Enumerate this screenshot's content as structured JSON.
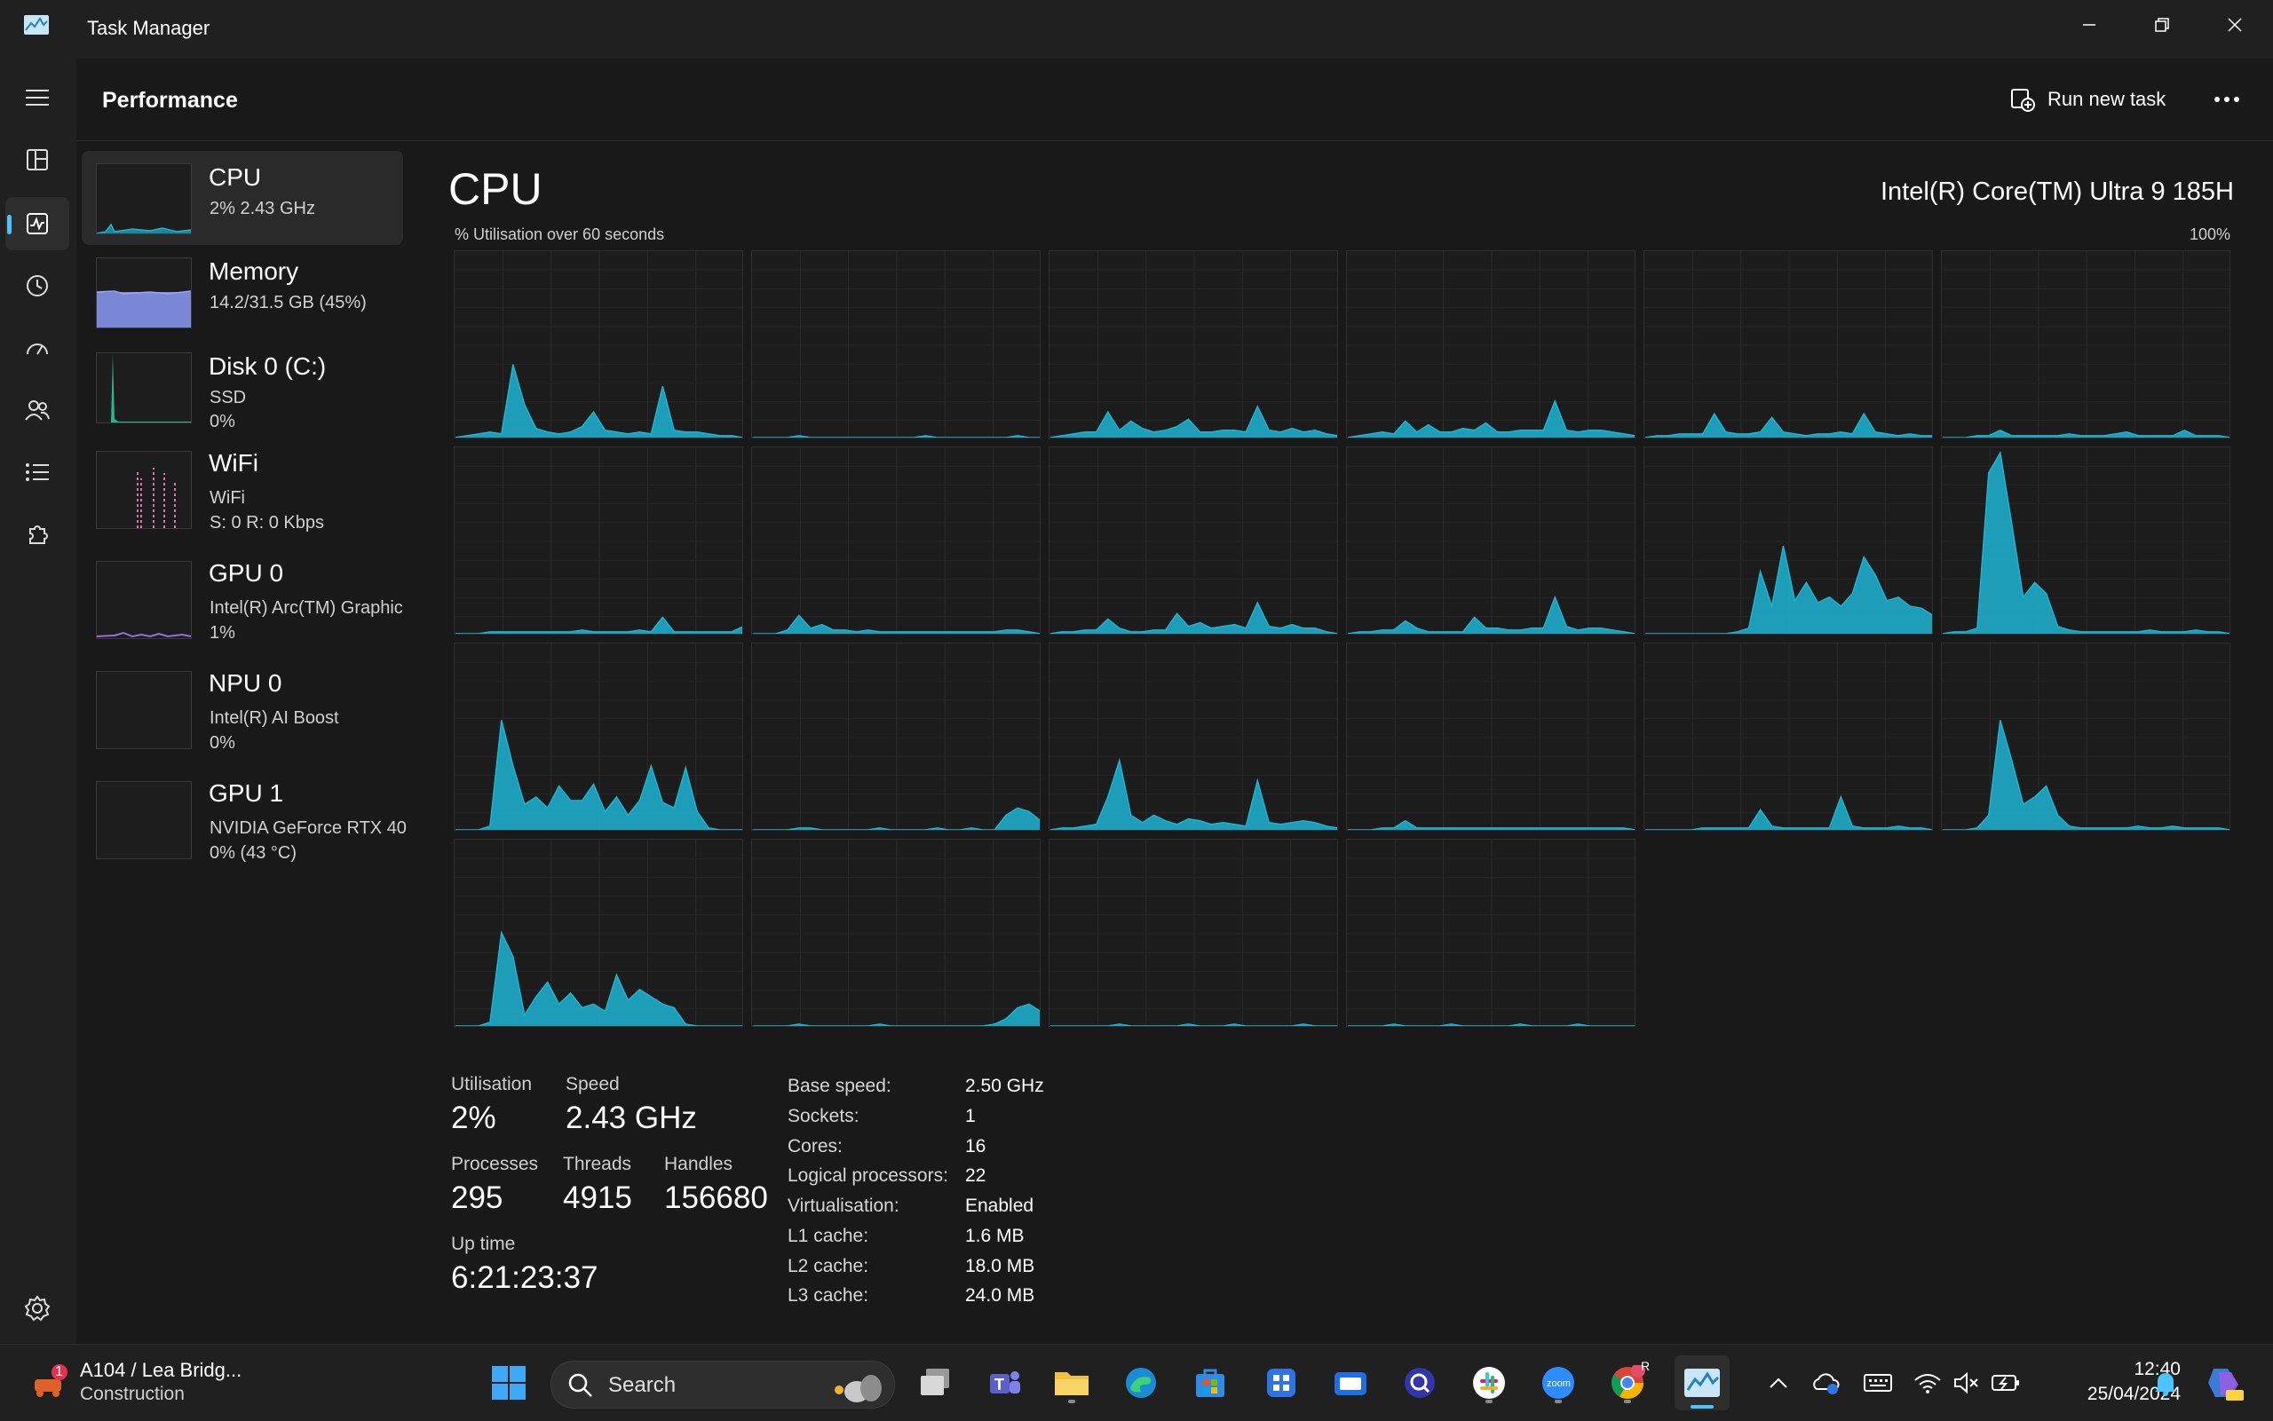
{
  "window": {
    "title": "Task Manager"
  },
  "header": {
    "title": "Performance",
    "run_task_label": "Run new task"
  },
  "sidebar": {
    "items": [
      {
        "name": "CPU",
        "sub1": "2% 2.43 GHz",
        "sub2": ""
      },
      {
        "name": "Memory",
        "sub1": "14.2/31.5 GB (45%)",
        "sub2": ""
      },
      {
        "name": "Disk 0 (C:)",
        "sub1": "SSD",
        "sub2": "0%"
      },
      {
        "name": "WiFi",
        "sub1": "WiFi",
        "sub2": "S: 0 R: 0 Kbps"
      },
      {
        "name": "GPU 0",
        "sub1": "Intel(R) Arc(TM) Graphic",
        "sub2": "1%"
      },
      {
        "name": "NPU 0",
        "sub1": "Intel(R) AI Boost",
        "sub2": "0%"
      },
      {
        "name": "GPU 1",
        "sub1": "NVIDIA GeForce RTX 40",
        "sub2": "0% (43 °C)"
      }
    ]
  },
  "main": {
    "title": "CPU",
    "model": "Intel(R) Core(TM) Ultra 9 185H",
    "graph_label": "% Utilisation over 60 seconds",
    "graph_max": "100%",
    "graph_color": "#1db4d3",
    "stats": {
      "utilisation_label": "Utilisation",
      "utilisation_value": "2%",
      "speed_label": "Speed",
      "speed_value": "2.43 GHz",
      "processes_label": "Processes",
      "processes_value": "295",
      "threads_label": "Threads",
      "threads_value": "4915",
      "handles_label": "Handles",
      "handles_value": "156680",
      "uptime_label": "Up time",
      "uptime_value": "6:21:23:37"
    },
    "specs": [
      {
        "label": "Base speed:",
        "value": "2.50 GHz"
      },
      {
        "label": "Sockets:",
        "value": "1"
      },
      {
        "label": "Cores:",
        "value": "16"
      },
      {
        "label": "Logical processors:",
        "value": "22"
      },
      {
        "label": "Virtualisation:",
        "value": "Enabled"
      },
      {
        "label": "L1 cache:",
        "value": "1.6 MB"
      },
      {
        "label": "L2 cache:",
        "value": "18.0 MB"
      },
      {
        "label": "L3 cache:",
        "value": "24.0 MB"
      }
    ]
  },
  "chart_data": {
    "type": "area",
    "x_label": "% Utilisation over 60 seconds",
    "ylim": [
      0,
      100
    ],
    "series": [
      {
        "values": [
          0,
          1,
          2,
          3,
          2,
          40,
          18,
          5,
          3,
          2,
          3,
          6,
          14,
          4,
          3,
          2,
          3,
          2,
          28,
          4,
          3,
          3,
          2,
          1,
          1,
          0
        ]
      },
      {
        "values": [
          0,
          0,
          0,
          0,
          1,
          0,
          0,
          0,
          0,
          0,
          0,
          0,
          0,
          0,
          0,
          1,
          0,
          0,
          0,
          0,
          0,
          0,
          0,
          1,
          0,
          0
        ]
      },
      {
        "values": [
          0,
          1,
          2,
          3,
          3,
          14,
          4,
          9,
          5,
          3,
          4,
          6,
          10,
          3,
          3,
          4,
          4,
          3,
          17,
          4,
          3,
          5,
          3,
          4,
          2,
          1
        ]
      },
      {
        "values": [
          0,
          1,
          2,
          3,
          2,
          9,
          3,
          7,
          3,
          3,
          5,
          4,
          8,
          3,
          3,
          4,
          4,
          4,
          20,
          4,
          3,
          4,
          4,
          3,
          2,
          1
        ]
      },
      {
        "values": [
          0,
          1,
          1,
          2,
          2,
          2,
          13,
          3,
          2,
          2,
          3,
          11,
          3,
          2,
          1,
          2,
          2,
          3,
          2,
          13,
          3,
          2,
          1,
          2,
          1,
          1
        ]
      },
      {
        "values": [
          0,
          0,
          0,
          1,
          1,
          4,
          1,
          1,
          1,
          1,
          1,
          2,
          1,
          1,
          1,
          2,
          3,
          1,
          1,
          1,
          1,
          4,
          1,
          1,
          1,
          0
        ]
      },
      {
        "values": [
          0,
          0,
          0,
          1,
          1,
          1,
          1,
          1,
          1,
          1,
          1,
          2,
          1,
          1,
          1,
          1,
          2,
          1,
          9,
          1,
          1,
          1,
          1,
          1,
          1,
          4
        ]
      },
      {
        "values": [
          0,
          0,
          0,
          2,
          10,
          3,
          5,
          2,
          2,
          1,
          2,
          1,
          1,
          1,
          1,
          1,
          1,
          1,
          1,
          1,
          1,
          1,
          2,
          2,
          1,
          0
        ]
      },
      {
        "values": [
          0,
          1,
          1,
          2,
          2,
          8,
          3,
          1,
          1,
          2,
          2,
          11,
          4,
          6,
          3,
          4,
          5,
          3,
          17,
          4,
          3,
          5,
          3,
          3,
          1,
          0
        ]
      },
      {
        "values": [
          0,
          1,
          1,
          2,
          2,
          7,
          3,
          1,
          1,
          1,
          1,
          9,
          3,
          3,
          2,
          2,
          3,
          3,
          20,
          4,
          2,
          3,
          3,
          2,
          1,
          0
        ]
      },
      {
        "values": [
          0,
          0,
          0,
          0,
          0,
          0,
          0,
          0,
          1,
          3,
          34,
          15,
          48,
          18,
          28,
          17,
          20,
          15,
          22,
          42,
          32,
          18,
          20,
          15,
          14,
          10
        ]
      },
      {
        "values": [
          0,
          1,
          1,
          3,
          88,
          99,
          60,
          20,
          28,
          22,
          4,
          2,
          1,
          1,
          1,
          1,
          1,
          1,
          2,
          1,
          1,
          1,
          2,
          1,
          1,
          0
        ]
      },
      {
        "values": [
          0,
          0,
          0,
          2,
          60,
          35,
          14,
          18,
          12,
          24,
          16,
          16,
          25,
          10,
          18,
          8,
          16,
          35,
          15,
          12,
          34,
          10,
          1,
          0,
          0,
          0
        ]
      },
      {
        "values": [
          0,
          0,
          0,
          0,
          1,
          1,
          0,
          0,
          0,
          0,
          0,
          1,
          0,
          0,
          0,
          0,
          1,
          0,
          0,
          1,
          0,
          0,
          8,
          12,
          10,
          5
        ]
      },
      {
        "values": [
          0,
          1,
          1,
          2,
          3,
          18,
          38,
          8,
          4,
          8,
          5,
          3,
          6,
          5,
          3,
          4,
          3,
          2,
          27,
          4,
          3,
          4,
          5,
          4,
          2,
          1
        ]
      },
      {
        "values": [
          0,
          0,
          0,
          1,
          1,
          5,
          1,
          1,
          1,
          1,
          1,
          1,
          1,
          1,
          1,
          1,
          1,
          1,
          1,
          1,
          1,
          1,
          1,
          1,
          1,
          0
        ]
      },
      {
        "values": [
          0,
          0,
          0,
          0,
          0,
          1,
          1,
          1,
          1,
          1,
          11,
          2,
          1,
          1,
          1,
          1,
          1,
          18,
          2,
          1,
          1,
          1,
          2,
          1,
          1,
          0
        ]
      },
      {
        "values": [
          0,
          0,
          0,
          1,
          8,
          60,
          38,
          14,
          18,
          24,
          8,
          2,
          1,
          1,
          1,
          1,
          1,
          2,
          1,
          1,
          2,
          1,
          1,
          1,
          1,
          0
        ]
      },
      {
        "values": [
          0,
          0,
          0,
          2,
          51,
          38,
          6,
          16,
          24,
          12,
          18,
          10,
          12,
          8,
          28,
          14,
          20,
          16,
          12,
          10,
          1,
          0,
          0,
          0,
          0,
          0
        ]
      },
      {
        "values": [
          0,
          0,
          0,
          0,
          1,
          0,
          0,
          0,
          0,
          0,
          0,
          1,
          0,
          0,
          0,
          0,
          0,
          0,
          0,
          0,
          0,
          1,
          4,
          10,
          12,
          8
        ]
      },
      {
        "values": [
          0,
          0,
          0,
          0,
          0,
          0,
          1,
          0,
          0,
          0,
          0,
          0,
          1,
          0,
          0,
          0,
          1,
          0,
          0,
          0,
          0,
          0,
          1,
          0,
          0,
          0
        ]
      },
      {
        "values": [
          0,
          0,
          0,
          0,
          1,
          0,
          0,
          0,
          0,
          1,
          0,
          0,
          0,
          0,
          0,
          1,
          0,
          0,
          0,
          0,
          1,
          0,
          0,
          0,
          0,
          0
        ]
      }
    ]
  },
  "taskbar": {
    "widget_title": "A104 / Lea Bridg...",
    "widget_sub": "Construction",
    "widget_badge": "1",
    "search_placeholder": "Search",
    "chrome_badge": "R",
    "time": "12:40",
    "date": "25/04/2024"
  }
}
